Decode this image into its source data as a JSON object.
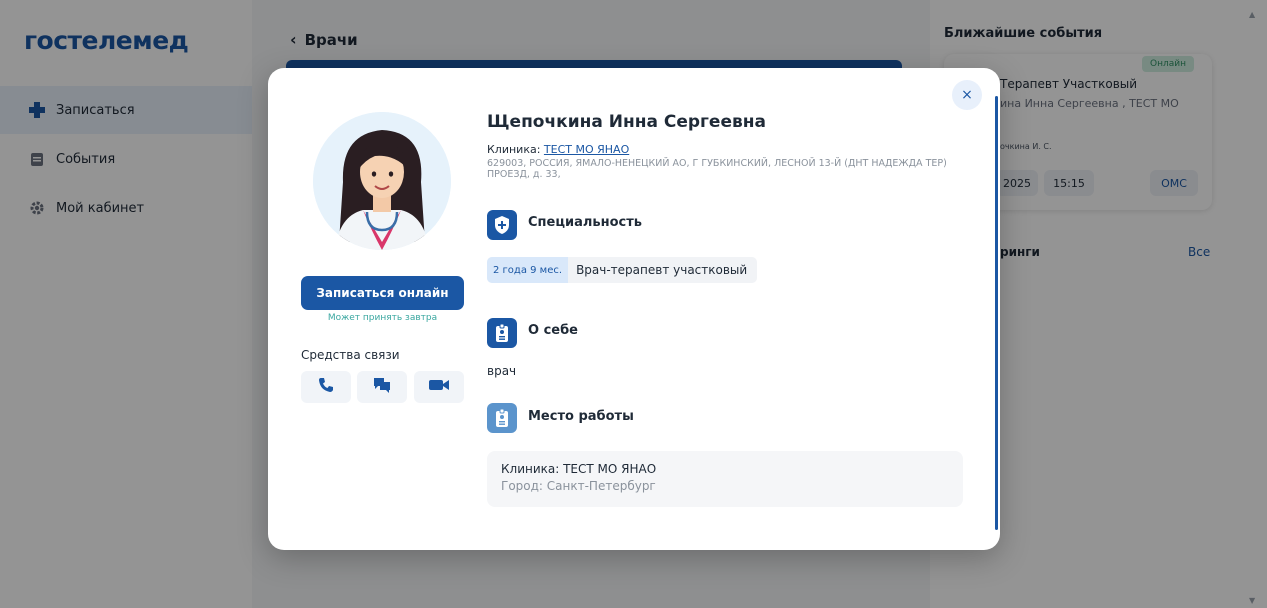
{
  "sidebar": {
    "logo": "гостелемед",
    "items": [
      {
        "label": "Записаться",
        "icon": "plus-icon"
      },
      {
        "label": "События",
        "icon": "calendar-icon"
      },
      {
        "label": "Мой кабинет",
        "icon": "gear-icon"
      }
    ]
  },
  "main": {
    "back_title": "Врачи"
  },
  "events": {
    "title": "Ближайшие события",
    "card": {
      "badge": "Онлайн",
      "doctor": "Терапевт Участковый",
      "clinic": "ина Инна Сергеевна , ТЕСТ МО",
      "short_name": "очкина И. С.",
      "date": "2025",
      "time": "15:15",
      "payment": "ОМС"
    },
    "section2_title": "ринги",
    "section2_all": "Все"
  },
  "modal": {
    "doctor_name": "Щепочкина Инна Сергеевна",
    "clinic_prefix": "Клиника: ",
    "clinic_link": "ТЕСТ МО ЯНАО",
    "address": "629003, РОССИЯ, ЯМАЛО-НЕНЕЦКИЙ АО, Г ГУБКИНСКИЙ, ЛЕСНОЙ 13-Й (ДНТ НАДЕЖДА ТЕР) ПРОЕЗД, д. 33,",
    "book_button": "Записаться онлайн",
    "may_accept": "Может принять завтра",
    "contacts_label": "Средства связи",
    "specialty_title": "Специальность",
    "experience": "2 года 9 мес.",
    "specialty": "Врач-терапевт участковый",
    "about_title": "О себе",
    "about_text": "врач",
    "work_title": "Место работы",
    "work_clinic": "Клиника: ТЕСТ МО ЯНАО",
    "work_city": "Город: Санкт-Петербург",
    "close": "×"
  },
  "colors": {
    "brand": "#1b57a4",
    "accent_teal": "#3aa7a0",
    "online_badge": "#cfeee0"
  }
}
